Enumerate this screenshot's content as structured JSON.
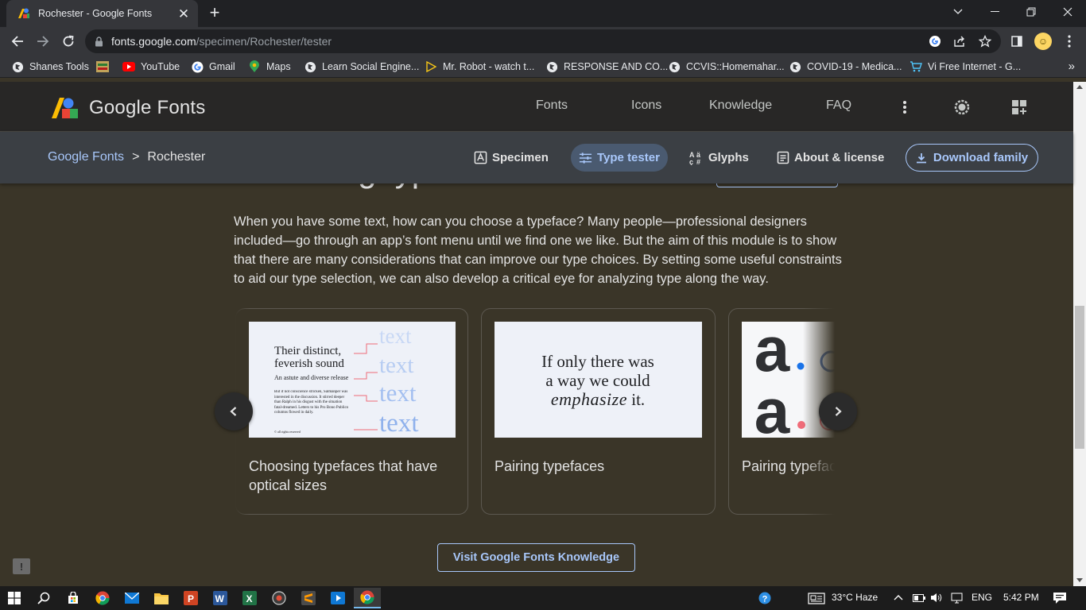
{
  "browser": {
    "tab_title": "Rochester - Google Fonts",
    "url_host": "fonts.google.com",
    "url_path": "/specimen/Rochester/tester",
    "bookmarks": [
      {
        "label": "Shanes Tools",
        "icon": "globe-icon"
      },
      {
        "label": "",
        "icon": "app-icon"
      },
      {
        "label": "YouTube",
        "icon": "youtube-icon"
      },
      {
        "label": "Gmail",
        "icon": "google-icon"
      },
      {
        "label": "Maps",
        "icon": "maps-icon"
      },
      {
        "label": "Learn Social Engine...",
        "icon": "globe-icon"
      },
      {
        "label": "Mr. Robot - watch t...",
        "icon": "play-icon"
      },
      {
        "label": "RESPONSE AND CO...",
        "icon": "globe-icon"
      },
      {
        "label": "CCVIS::Homemahar...",
        "icon": "globe-icon"
      },
      {
        "label": "COVID-19 - Medica...",
        "icon": "globe-icon"
      },
      {
        "label": "Vi Free Internet - G...",
        "icon": "cart-icon"
      }
    ],
    "bookmarks_more": "»"
  },
  "header": {
    "logo_text": "Google Fonts",
    "nav": [
      "Fonts",
      "Icons",
      "Knowledge",
      "FAQ"
    ]
  },
  "subnav": {
    "breadcrumb_root": "Google Fonts",
    "breadcrumb_sep": ">",
    "breadcrumb_current": "Rochester",
    "tabs": [
      "Specimen",
      "Type tester",
      "Glyphs",
      "About & license"
    ],
    "active_tab": "Type tester",
    "download_label": "Download family"
  },
  "main": {
    "heading": "Choosing type",
    "intro": "When you have some text, how can you choose a typeface? Many people—professional designers included—go through an app’s font menu until we find one we like. But the aim of this module is to show that there are many considerations that can improve our type choices. By setting some useful constraints to aid our type selection, we can also develop a critical eye for analyzing type along the way.",
    "cards": [
      {
        "caption": "Choosing typefaces that have optical sizes",
        "img": {
          "line1": "Their distinct,",
          "line2": "feverish sound",
          "line3": "An astute and diverse release",
          "para": "But if not conscience stricken, Salmanper was interested in the discussion. It stirred deeper than Ralph in his disgust with the situation fatal-dreamed. Letters to his Pro Bono Publico columns flowed in daily.",
          "foot": "© all rights reserved",
          "side_word": "text"
        }
      },
      {
        "caption": "Pairing typefaces",
        "img": {
          "line1": "If only there was",
          "line2": "a way we could",
          "line3_script": "emphasize",
          "line3_rest": " it."
        }
      },
      {
        "caption": "Pairing typefaces & superfamily",
        "img": {
          "letter": "a"
        }
      }
    ],
    "visit_label": "Visit Google Fonts Knowledge",
    "feedback_icon": "feedback-icon"
  },
  "taskbar": {
    "weather": "33°C  Haze",
    "language": "ENG",
    "time": "5:42 PM"
  },
  "colors": {
    "page_bg": "#3a3528",
    "header_bg": "#282726",
    "subnav_bg": "#3b3f44",
    "accent": "#a8c7fa"
  }
}
